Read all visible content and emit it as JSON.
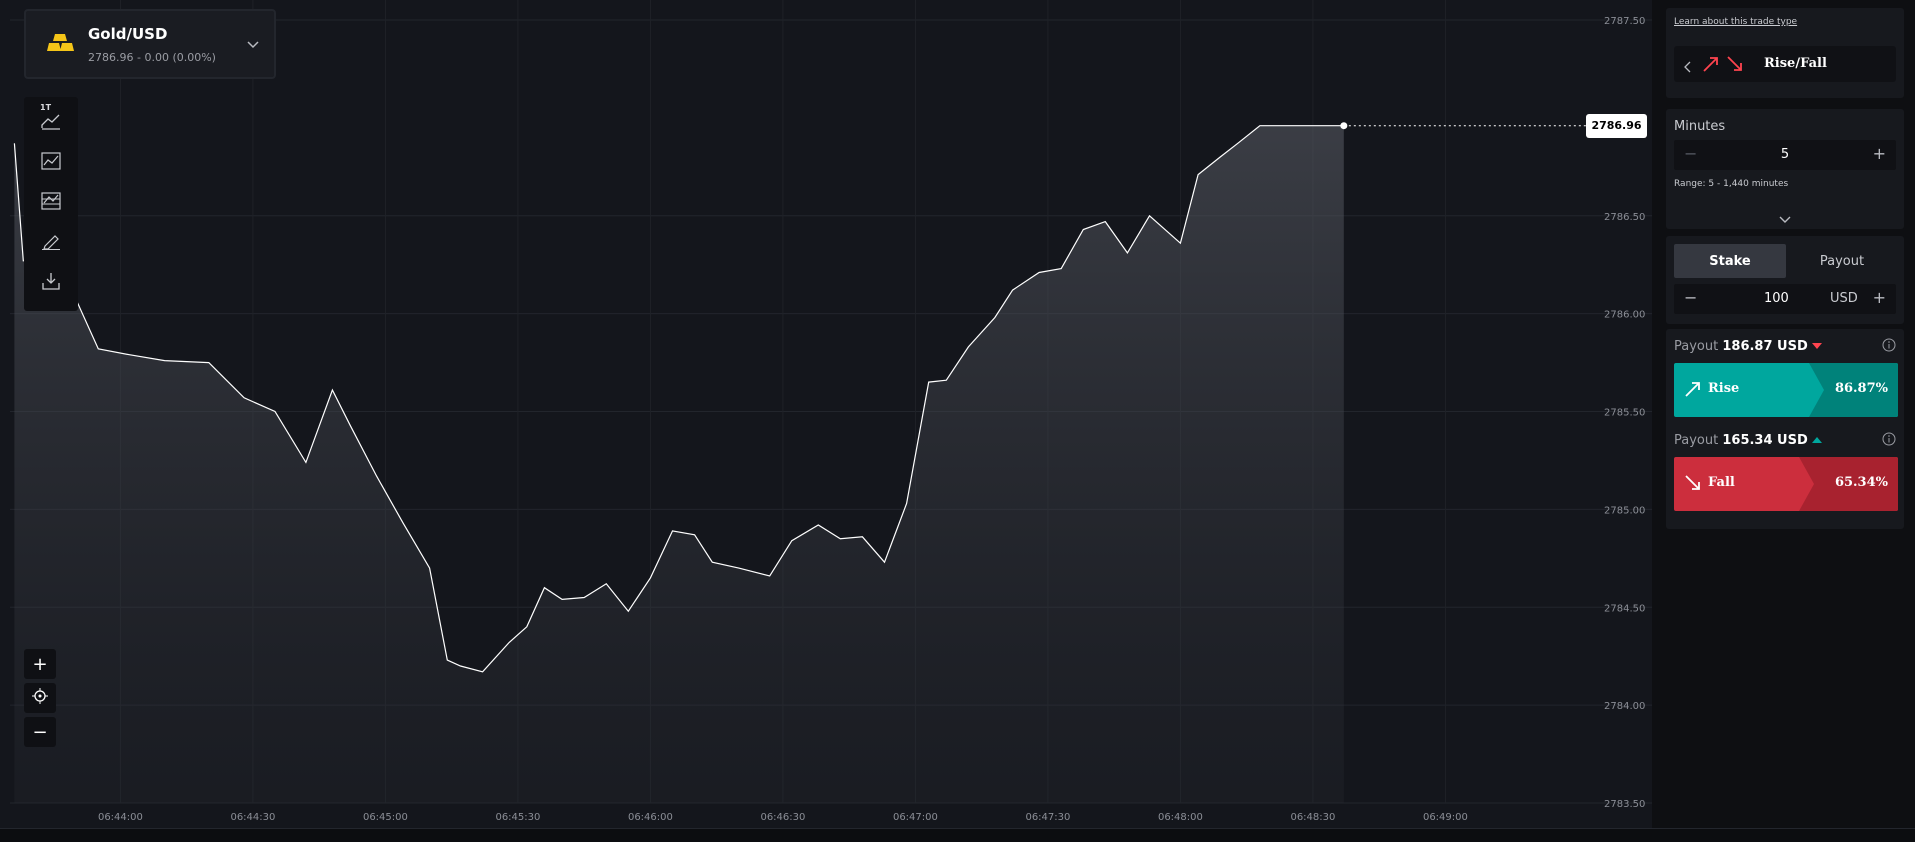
{
  "instrument": {
    "name": "Gold/USD",
    "quote": "2786.96 - 0.00 (0.00%)",
    "icon": "gold-bars-icon",
    "icon_color": "#f5c518"
  },
  "toolbar": {
    "tick_badge": "1T",
    "tools": [
      "area-chart-icon",
      "indicators-icon",
      "chart-table-icon",
      "draw-pencil-icon",
      "download-icon"
    ]
  },
  "zoom": {
    "zoom_in": "+",
    "zoom_out": "−",
    "reset_icon": "crosshair-icon"
  },
  "chart": {
    "current_price": "2786.96",
    "price_ticks": [
      "2787.50",
      "2786.50",
      "2786.00",
      "2785.50",
      "2785.00",
      "2784.50",
      "2784.00",
      "2783.50"
    ],
    "time_ticks": [
      "06:44:00",
      "06:44:30",
      "06:45:00",
      "06:45:30",
      "06:46:00",
      "06:46:30",
      "06:47:00",
      "06:47:30",
      "06:48:00",
      "06:48:30",
      "06:49:00"
    ]
  },
  "chart_data": {
    "type": "area",
    "symbol": "Gold/USD",
    "ylim": [
      2783.5,
      2787.5
    ],
    "xlim": [
      "06:43:35",
      "06:49:35"
    ],
    "x": [
      "06:43:36",
      "06:43:38",
      "06:43:46",
      "06:43:55",
      "06:44:02",
      "06:44:10",
      "06:44:20",
      "06:44:28",
      "06:44:35",
      "06:44:42",
      "06:44:48",
      "06:44:52",
      "06:44:58",
      "06:45:04",
      "06:45:10",
      "06:45:14",
      "06:45:17",
      "06:45:22",
      "06:45:28",
      "06:45:32",
      "06:45:36",
      "06:45:40",
      "06:45:45",
      "06:45:50",
      "06:45:55",
      "06:46:00",
      "06:46:05",
      "06:46:10",
      "06:46:14",
      "06:46:20",
      "06:46:27",
      "06:46:32",
      "06:46:38",
      "06:46:43",
      "06:46:48",
      "06:46:53",
      "06:46:58",
      "06:47:03",
      "06:47:07",
      "06:47:12",
      "06:47:18",
      "06:47:22",
      "06:47:28",
      "06:47:33",
      "06:47:38",
      "06:47:43",
      "06:47:48",
      "06:47:53",
      "06:48:00",
      "06:48:04",
      "06:48:09",
      "06:48:13",
      "06:48:18",
      "06:48:23",
      "06:48:28",
      "06:48:32",
      "06:48:37"
    ],
    "y": [
      2786.87,
      2786.27,
      2786.27,
      2785.82,
      2785.79,
      2785.76,
      2785.75,
      2785.57,
      2785.5,
      2785.24,
      2785.61,
      2785.43,
      2785.17,
      2784.93,
      2784.7,
      2784.23,
      2784.2,
      2784.17,
      2784.32,
      2784.4,
      2784.6,
      2784.54,
      2784.55,
      2784.62,
      2784.48,
      2784.65,
      2784.89,
      2784.87,
      2784.73,
      2784.7,
      2784.66,
      2784.84,
      2784.92,
      2784.85,
      2784.86,
      2784.73,
      2785.03,
      2785.65,
      2785.66,
      2785.83,
      2785.98,
      2786.12,
      2786.21,
      2786.23,
      2786.43,
      2786.47,
      2786.31,
      2786.5,
      2786.36,
      2786.71,
      2786.8,
      2786.87,
      2786.96,
      2786.96,
      2786.96,
      2786.96,
      2786.96
    ],
    "last_value": 2786.96,
    "grid": true,
    "line_color": "#ffffff"
  },
  "panel": {
    "learn_link": "Learn about this trade type",
    "trade_type": "Rise/Fall",
    "duration": {
      "unit_label": "Minutes",
      "value": "5",
      "range": "Range: 5 - 1,440 minutes"
    },
    "amount": {
      "tab_stake": "Stake",
      "tab_payout": "Payout",
      "value": "100",
      "currency": "USD"
    },
    "rise": {
      "payout_label": "Payout",
      "payout_value": "186.87 USD",
      "label": "Rise",
      "percent": "86.87%",
      "color": "#00a79e"
    },
    "fall": {
      "payout_label": "Payout",
      "payout_value": "165.34 USD",
      "label": "Fall",
      "percent": "65.34%",
      "color": "#cc2e3d"
    }
  }
}
